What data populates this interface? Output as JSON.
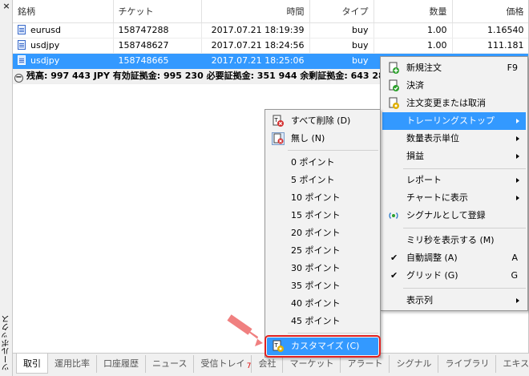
{
  "sidebar": {
    "close": "×",
    "label": "ツールボックス"
  },
  "table": {
    "headers": [
      "銘柄",
      "チケット",
      "時間",
      "タイプ",
      "数量",
      "価格"
    ],
    "rows": [
      {
        "symbol": "eurusd",
        "ticket": "158747288",
        "time": "2017.07.21 18:19:39",
        "type": "buy",
        "volume": "1.00",
        "price": "1.16540"
      },
      {
        "symbol": "usdjpy",
        "ticket": "158748627",
        "time": "2017.07.21 18:24:56",
        "type": "buy",
        "volume": "1.00",
        "price": "111.181"
      },
      {
        "symbol": "usdjpy",
        "ticket": "158748665",
        "time": "2017.07.21 18:25:06",
        "type": "buy",
        "volume": "",
        "price": ""
      }
    ],
    "balance_text": "残高: 997 443 JPY  有効証拠金: 995 230  必要証拠金: 351 944  余剰証拠金: 643 28"
  },
  "context_menu": {
    "items": [
      {
        "label": "新規注文",
        "shortcut": "F9",
        "icon": "new-order-icon"
      },
      {
        "label": "決済",
        "icon": "close-position-icon"
      },
      {
        "label": "注文変更または取消",
        "icon": "modify-order-icon"
      },
      {
        "label": "トレーリングストップ",
        "submenu": true,
        "highlighted": true
      },
      {
        "label": "数量表示単位",
        "submenu": true
      },
      {
        "label": "損益",
        "submenu": true
      },
      {
        "label": "レポート",
        "submenu": true
      },
      {
        "label": "チャートに表示",
        "submenu": true
      },
      {
        "label": "シグナルとして登録",
        "icon": "signal-icon"
      },
      {
        "label": "ミリ秒を表示する (M)"
      },
      {
        "label": "自動調整 (A)",
        "shortcut": "A",
        "checked": true
      },
      {
        "label": "グリッド (G)",
        "shortcut": "G",
        "checked": true
      },
      {
        "label": "表示列",
        "submenu": true
      }
    ]
  },
  "trailing_submenu": {
    "items": [
      {
        "label": "すべて削除 (D)"
      },
      {
        "label": "無し (N)"
      },
      {
        "label": "0 ポイント"
      },
      {
        "label": "5 ポイント"
      },
      {
        "label": "10 ポイント"
      },
      {
        "label": "15 ポイント"
      },
      {
        "label": "20 ポイント"
      },
      {
        "label": "25 ポイント"
      },
      {
        "label": "30 ポイント"
      },
      {
        "label": "35 ポイント"
      },
      {
        "label": "40 ポイント"
      },
      {
        "label": "45 ポイント"
      },
      {
        "label": "カスタマイズ (C)"
      }
    ]
  },
  "tabs": [
    {
      "label": "取引",
      "active": true
    },
    {
      "label": "運用比率"
    },
    {
      "label": "口座履歴"
    },
    {
      "label": "ニュース"
    },
    {
      "label": "受信トレイ",
      "badge": "7"
    },
    {
      "label": "会社"
    },
    {
      "label": "マーケット"
    },
    {
      "label": "アラート"
    },
    {
      "label": "シグナル"
    },
    {
      "label": "ライブラリ"
    },
    {
      "label": "エキスパー"
    }
  ],
  "colors": {
    "selection": "#3399ff",
    "callout_arrow": "#f08080",
    "highlight_border": "#e02020"
  }
}
